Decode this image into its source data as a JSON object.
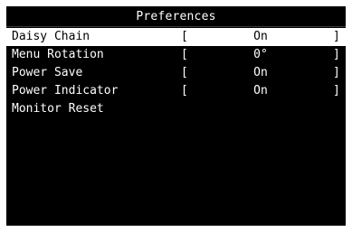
{
  "osd": {
    "title": "Preferences",
    "items": [
      {
        "label": "Daisy Chain",
        "open": "[",
        "value": "On",
        "close": "]",
        "selected": true
      },
      {
        "label": "Menu Rotation",
        "open": "[",
        "value": "0°",
        "close": "]",
        "selected": false
      },
      {
        "label": "Power Save",
        "open": "[",
        "value": "On",
        "close": "]",
        "selected": false
      },
      {
        "label": "Power Indicator",
        "open": "[",
        "value": "On",
        "close": "]",
        "selected": false
      },
      {
        "label": "Monitor Reset",
        "open": "",
        "value": "",
        "close": "",
        "selected": false
      }
    ]
  },
  "colors": {
    "panel_background": "#000000",
    "text": "#ffffff",
    "selected_background": "#ffffff",
    "selected_text": "#000000"
  }
}
